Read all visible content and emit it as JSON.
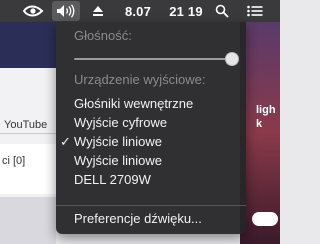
{
  "background": {
    "tab_label": "YouTube",
    "counter_text": "ci [0]",
    "right_caption_1": "ligh",
    "right_caption_2": "k"
  },
  "menubar": {
    "date": "8.07",
    "time": "21 19",
    "icons": [
      "nvidia-icon",
      "volume-icon",
      "eject-icon",
      "search-icon",
      "list-icon"
    ]
  },
  "volume_menu": {
    "volume_header": "Głośność:",
    "volume_level": 1.0,
    "output_header": "Urządzenie wyjściowe:",
    "devices": [
      {
        "label": "Głośniki wewnętrzne",
        "checked": false
      },
      {
        "label": "Wyjście cyfrowe",
        "checked": false
      },
      {
        "label": "Wyjście liniowe",
        "checked": true
      },
      {
        "label": "Wyjście liniowe",
        "checked": false
      },
      {
        "label": "DELL 2709W",
        "checked": false
      }
    ],
    "preferences_label": "Preferencje dźwięku..."
  },
  "colors": {
    "menubar": "#3a3a3c",
    "menu_bg": "#262628",
    "header_text": "#8b8b8f"
  }
}
